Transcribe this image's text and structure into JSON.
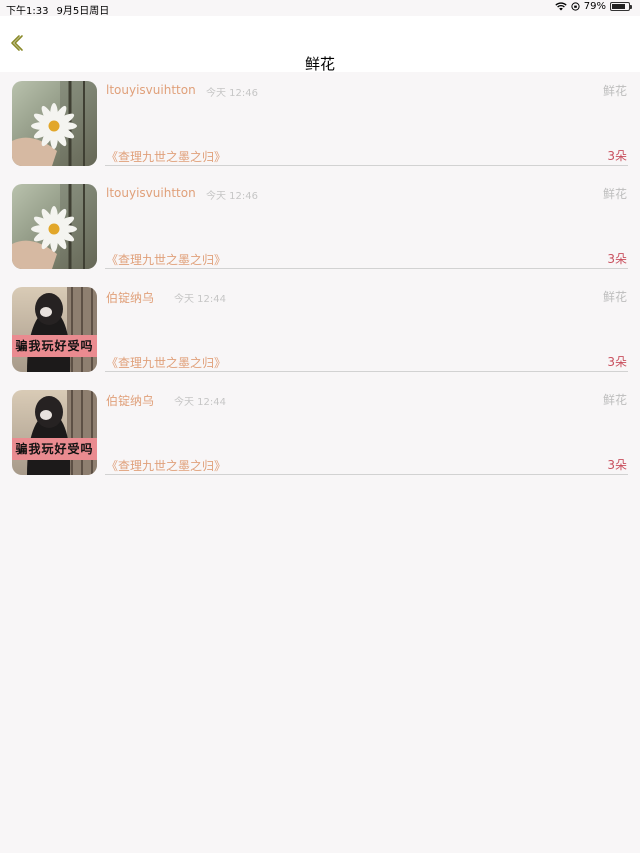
{
  "status_bar": {
    "time": "下午1:33",
    "date": "9月5日周日",
    "battery_text": "79%",
    "battery_level": 0.79
  },
  "navbar": {
    "title": "鲜花",
    "back_icon": "chevron-left-icon",
    "accent_color": "#8a8a2a"
  },
  "items": [
    {
      "name": "ltouyisvuihtton",
      "time": "今天 12:46",
      "type": "鲜花",
      "book": "《查理九世之墨之归》",
      "count": "3朵",
      "avatar": "daisy-photo"
    },
    {
      "name": "ltouyisvuihtton",
      "time": "今天 12:46",
      "type": "鲜花",
      "book": "《查理九世之墨之归》",
      "count": "3朵",
      "avatar": "daisy-photo"
    },
    {
      "name": "伯锭纳乌",
      "time": "今天 12:44",
      "type": "鲜花",
      "book": "《查理九世之墨之归》",
      "count": "3朵",
      "avatar": "girl-photo",
      "avatar_caption": "骗我玩好受吗"
    },
    {
      "name": "伯锭纳乌",
      "time": "今天 12:44",
      "type": "鲜花",
      "book": "《查理九世之墨之归》",
      "count": "3朵",
      "avatar": "girl-photo",
      "avatar_caption": "骗我玩好受吗"
    }
  ]
}
